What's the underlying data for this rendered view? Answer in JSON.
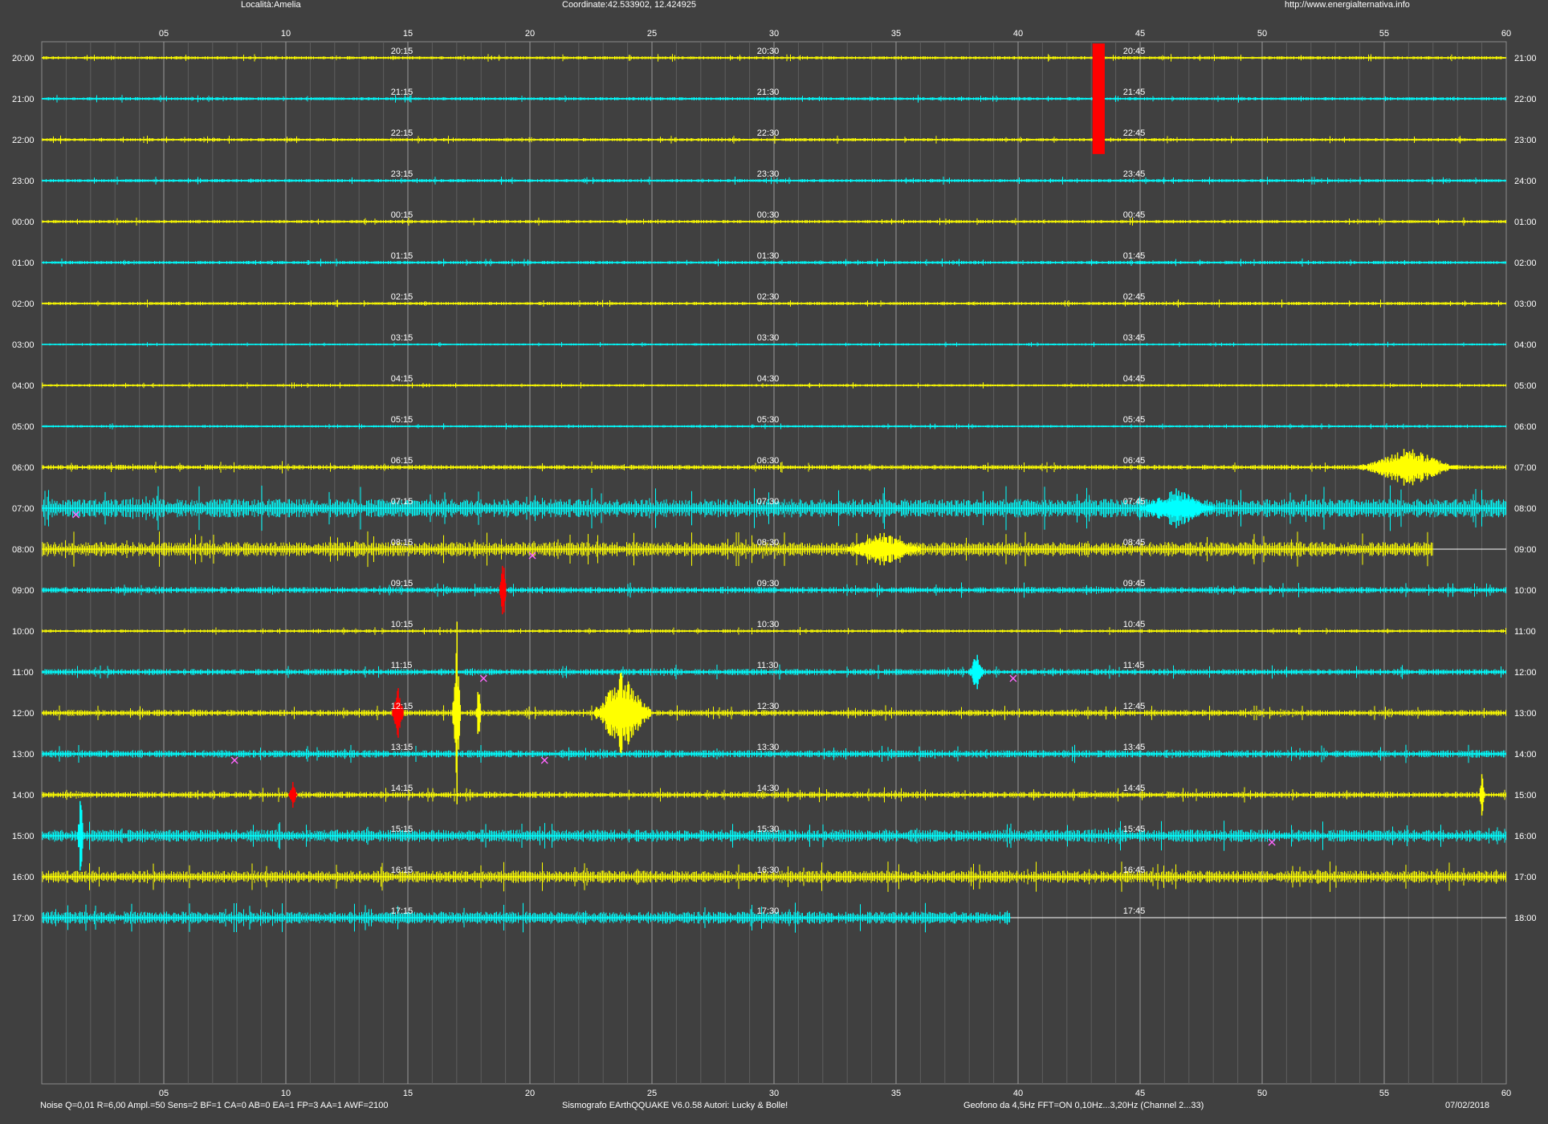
{
  "header": {
    "location": "Località:Amelia",
    "coordinates": "Coordinate:42.533902, 12.424925",
    "url": "http://www.energialternativa.info"
  },
  "footer": {
    "params": "Noise Q=0,01 R=6,00 Ampl.=50 Sens=2 BF=1 CA=0 AB=0 EA=1 FP=3 AA=1 AWF=2100",
    "software": "Sismografo EArthQQUAKE  V6.0.58   Autori: Lucky & Bolle!",
    "geophone": "Geofono da 4,5Hz FFT=ON 0,10Hz...3,20Hz      (Channel 2...33)",
    "date": "07/02/2018"
  },
  "colors": {
    "background": "#404040",
    "grid": "#8a8a8a",
    "trace_a": "#ffff00",
    "trace_b": "#00ffff",
    "event": "#ff0000",
    "marker": "#ff66ff",
    "text": "#ffffff"
  },
  "chart_data": {
    "type": "line",
    "x_range": [
      0,
      60
    ],
    "x_ticks": [
      "05",
      "10",
      "15",
      "20",
      "25",
      "30",
      "35",
      "40",
      "45",
      "50",
      "55",
      "60"
    ],
    "x_tick_values": [
      5,
      10,
      15,
      20,
      25,
      30,
      35,
      40,
      45,
      50,
      55,
      60
    ],
    "rows": [
      {
        "left": "20:00",
        "right": "21:00",
        "q1": "20:15",
        "q2": "20:30",
        "q3": "20:45",
        "color": "yellow",
        "amp": 0.08,
        "end": 60
      },
      {
        "left": "21:00",
        "right": "22:00",
        "q1": "21:15",
        "q2": "21:30",
        "q3": "21:45",
        "color": "cyan",
        "amp": 0.08,
        "end": 60
      },
      {
        "left": "22:00",
        "right": "23:00",
        "q1": "22:15",
        "q2": "22:30",
        "q3": "22:45",
        "color": "yellow",
        "amp": 0.08,
        "end": 60
      },
      {
        "left": "23:00",
        "right": "24:00",
        "q1": "23:15",
        "q2": "23:30",
        "q3": "23:45",
        "color": "cyan",
        "amp": 0.08,
        "end": 60
      },
      {
        "left": "00:00",
        "right": "01:00",
        "q1": "00:15",
        "q2": "00:30",
        "q3": "00:45",
        "color": "yellow",
        "amp": 0.08,
        "end": 60
      },
      {
        "left": "01:00",
        "right": "02:00",
        "q1": "01:15",
        "q2": "01:30",
        "q3": "01:45",
        "color": "cyan",
        "amp": 0.08,
        "end": 60
      },
      {
        "left": "02:00",
        "right": "03:00",
        "q1": "02:15",
        "q2": "02:30",
        "q3": "02:45",
        "color": "yellow",
        "amp": 0.08,
        "end": 60
      },
      {
        "left": "03:00",
        "right": "04:00",
        "q1": "03:15",
        "q2": "03:30",
        "q3": "03:45",
        "color": "cyan",
        "amp": 0.05,
        "end": 60
      },
      {
        "left": "04:00",
        "right": "05:00",
        "q1": "04:15",
        "q2": "04:30",
        "q3": "04:45",
        "color": "yellow",
        "amp": 0.06,
        "end": 60
      },
      {
        "left": "05:00",
        "right": "06:00",
        "q1": "05:15",
        "q2": "05:30",
        "q3": "05:45",
        "color": "cyan",
        "amp": 0.06,
        "end": 60
      },
      {
        "left": "06:00",
        "right": "07:00",
        "q1": "06:15",
        "q2": "06:30",
        "q3": "06:45",
        "color": "yellow",
        "amp": 0.12,
        "end": 60
      },
      {
        "left": "07:00",
        "right": "08:00",
        "q1": "07:15",
        "q2": "07:30",
        "q3": "07:45",
        "color": "cyan",
        "amp": 0.45,
        "end": 60
      },
      {
        "left": "08:00",
        "right": "09:00",
        "q1": "08:15",
        "q2": "08:30",
        "q3": "08:45",
        "color": "yellow",
        "amp": 0.35,
        "end": 57
      },
      {
        "left": "09:00",
        "right": "10:00",
        "q1": "09:15",
        "q2": "09:30",
        "q3": "09:45",
        "color": "cyan",
        "amp": 0.15,
        "end": 60
      },
      {
        "left": "10:00",
        "right": "11:00",
        "q1": "10:15",
        "q2": "10:30",
        "q3": "10:45",
        "color": "yellow",
        "amp": 0.08,
        "end": 60
      },
      {
        "left": "11:00",
        "right": "12:00",
        "q1": "11:15",
        "q2": "11:30",
        "q3": "11:45",
        "color": "cyan",
        "amp": 0.15,
        "end": 60
      },
      {
        "left": "12:00",
        "right": "13:00",
        "q1": "12:15",
        "q2": "12:30",
        "q3": "12:45",
        "color": "yellow",
        "amp": 0.15,
        "end": 60
      },
      {
        "left": "13:00",
        "right": "14:00",
        "q1": "13:15",
        "q2": "13:30",
        "q3": "13:45",
        "color": "cyan",
        "amp": 0.18,
        "end": 60
      },
      {
        "left": "14:00",
        "right": "15:00",
        "q1": "14:15",
        "q2": "14:30",
        "q3": "14:45",
        "color": "yellow",
        "amp": 0.15,
        "end": 60
      },
      {
        "left": "15:00",
        "right": "16:00",
        "q1": "15:15",
        "q2": "15:30",
        "q3": "15:45",
        "color": "cyan",
        "amp": 0.3,
        "end": 60
      },
      {
        "left": "16:00",
        "right": "17:00",
        "q1": "16:15",
        "q2": "16:30",
        "q3": "16:45",
        "color": "yellow",
        "amp": 0.3,
        "end": 60
      },
      {
        "left": "17:00",
        "right": "18:00",
        "q1": "17:15",
        "q2": "17:30",
        "q3": "17:45",
        "color": "cyan",
        "amp": 0.3,
        "end": 39.7
      }
    ],
    "events": [
      {
        "row": 0,
        "x": 43.3,
        "amp": 0.45,
        "color": "red",
        "w": 0.5,
        "span": 3
      },
      {
        "row": 13,
        "x": 18.9,
        "amp": 1.1,
        "color": "red",
        "w": 0.25
      },
      {
        "row": 16,
        "x": 14.6,
        "amp": 0.7,
        "color": "red",
        "w": 0.45
      },
      {
        "row": 18,
        "x": 10.3,
        "amp": 0.35,
        "color": "red",
        "w": 0.35
      },
      {
        "row": 16,
        "x": 17.0,
        "amp": 2.5,
        "color": "yellow",
        "w": 0.3
      },
      {
        "row": 16,
        "x": 17.9,
        "amp": 0.8,
        "color": "yellow",
        "w": 0.2
      },
      {
        "row": 16,
        "x": 23.8,
        "amp": 1.05,
        "color": "yellow",
        "w": 2.3
      },
      {
        "row": 19,
        "x": 1.6,
        "amp": 1.1,
        "color": "cyan",
        "w": 0.25
      },
      {
        "row": 11,
        "x": 46.5,
        "amp": 0.5,
        "color": "cyan",
        "w": 3.0
      },
      {
        "row": 12,
        "x": 34.5,
        "amp": 0.45,
        "color": "yellow",
        "w": 3.0
      },
      {
        "row": 10,
        "x": 56.0,
        "amp": 0.5,
        "color": "yellow",
        "w": 4.0
      },
      {
        "row": 18,
        "x": 59.0,
        "amp": 0.6,
        "color": "yellow",
        "w": 0.2
      },
      {
        "row": 15,
        "x": 38.3,
        "amp": 0.5,
        "color": "cyan",
        "w": 0.6
      }
    ],
    "markers": [
      {
        "row": 11,
        "x": 1.4
      },
      {
        "row": 12,
        "x": 20.1
      },
      {
        "row": 15,
        "x": 18.1
      },
      {
        "row": 15,
        "x": 39.8
      },
      {
        "row": 17,
        "x": 7.9
      },
      {
        "row": 17,
        "x": 20.6
      },
      {
        "row": 19,
        "x": 50.4
      }
    ]
  }
}
